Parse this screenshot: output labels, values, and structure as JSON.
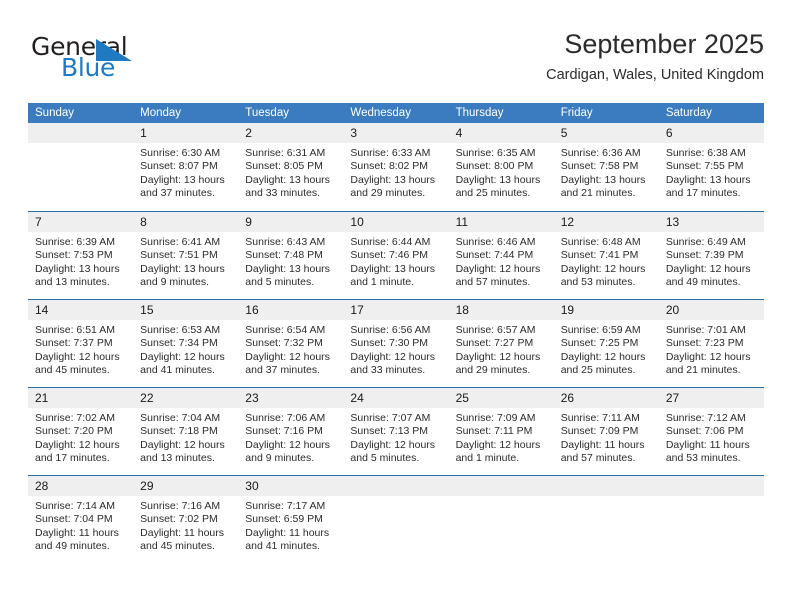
{
  "brand": {
    "name_top": "General",
    "name_bottom": "Blue",
    "triangle_color": "#1f7ac2",
    "top_color": "#231f20"
  },
  "header": {
    "title": "September 2025",
    "location": "Cardigan, Wales, United Kingdom"
  },
  "theme": {
    "header_row_bg": "#3a7cbf",
    "row_divider": "#2b6ca8",
    "day_band_bg": "#efefef",
    "text": "#2b2b2b"
  },
  "weekdays": [
    "Sunday",
    "Monday",
    "Tuesday",
    "Wednesday",
    "Thursday",
    "Friday",
    "Saturday"
  ],
  "weeks": [
    [
      {
        "day": "",
        "lines": []
      },
      {
        "day": "1",
        "lines": [
          "Sunrise: 6:30 AM",
          "Sunset: 8:07 PM",
          "Daylight: 13 hours",
          "and 37 minutes."
        ]
      },
      {
        "day": "2",
        "lines": [
          "Sunrise: 6:31 AM",
          "Sunset: 8:05 PM",
          "Daylight: 13 hours",
          "and 33 minutes."
        ]
      },
      {
        "day": "3",
        "lines": [
          "Sunrise: 6:33 AM",
          "Sunset: 8:02 PM",
          "Daylight: 13 hours",
          "and 29 minutes."
        ]
      },
      {
        "day": "4",
        "lines": [
          "Sunrise: 6:35 AM",
          "Sunset: 8:00 PM",
          "Daylight: 13 hours",
          "and 25 minutes."
        ]
      },
      {
        "day": "5",
        "lines": [
          "Sunrise: 6:36 AM",
          "Sunset: 7:58 PM",
          "Daylight: 13 hours",
          "and 21 minutes."
        ]
      },
      {
        "day": "6",
        "lines": [
          "Sunrise: 6:38 AM",
          "Sunset: 7:55 PM",
          "Daylight: 13 hours",
          "and 17 minutes."
        ]
      }
    ],
    [
      {
        "day": "7",
        "lines": [
          "Sunrise: 6:39 AM",
          "Sunset: 7:53 PM",
          "Daylight: 13 hours",
          "and 13 minutes."
        ]
      },
      {
        "day": "8",
        "lines": [
          "Sunrise: 6:41 AM",
          "Sunset: 7:51 PM",
          "Daylight: 13 hours",
          "and 9 minutes."
        ]
      },
      {
        "day": "9",
        "lines": [
          "Sunrise: 6:43 AM",
          "Sunset: 7:48 PM",
          "Daylight: 13 hours",
          "and 5 minutes."
        ]
      },
      {
        "day": "10",
        "lines": [
          "Sunrise: 6:44 AM",
          "Sunset: 7:46 PM",
          "Daylight: 13 hours",
          "and 1 minute."
        ]
      },
      {
        "day": "11",
        "lines": [
          "Sunrise: 6:46 AM",
          "Sunset: 7:44 PM",
          "Daylight: 12 hours",
          "and 57 minutes."
        ]
      },
      {
        "day": "12",
        "lines": [
          "Sunrise: 6:48 AM",
          "Sunset: 7:41 PM",
          "Daylight: 12 hours",
          "and 53 minutes."
        ]
      },
      {
        "day": "13",
        "lines": [
          "Sunrise: 6:49 AM",
          "Sunset: 7:39 PM",
          "Daylight: 12 hours",
          "and 49 minutes."
        ]
      }
    ],
    [
      {
        "day": "14",
        "lines": [
          "Sunrise: 6:51 AM",
          "Sunset: 7:37 PM",
          "Daylight: 12 hours",
          "and 45 minutes."
        ]
      },
      {
        "day": "15",
        "lines": [
          "Sunrise: 6:53 AM",
          "Sunset: 7:34 PM",
          "Daylight: 12 hours",
          "and 41 minutes."
        ]
      },
      {
        "day": "16",
        "lines": [
          "Sunrise: 6:54 AM",
          "Sunset: 7:32 PM",
          "Daylight: 12 hours",
          "and 37 minutes."
        ]
      },
      {
        "day": "17",
        "lines": [
          "Sunrise: 6:56 AM",
          "Sunset: 7:30 PM",
          "Daylight: 12 hours",
          "and 33 minutes."
        ]
      },
      {
        "day": "18",
        "lines": [
          "Sunrise: 6:57 AM",
          "Sunset: 7:27 PM",
          "Daylight: 12 hours",
          "and 29 minutes."
        ]
      },
      {
        "day": "19",
        "lines": [
          "Sunrise: 6:59 AM",
          "Sunset: 7:25 PM",
          "Daylight: 12 hours",
          "and 25 minutes."
        ]
      },
      {
        "day": "20",
        "lines": [
          "Sunrise: 7:01 AM",
          "Sunset: 7:23 PM",
          "Daylight: 12 hours",
          "and 21 minutes."
        ]
      }
    ],
    [
      {
        "day": "21",
        "lines": [
          "Sunrise: 7:02 AM",
          "Sunset: 7:20 PM",
          "Daylight: 12 hours",
          "and 17 minutes."
        ]
      },
      {
        "day": "22",
        "lines": [
          "Sunrise: 7:04 AM",
          "Sunset: 7:18 PM",
          "Daylight: 12 hours",
          "and 13 minutes."
        ]
      },
      {
        "day": "23",
        "lines": [
          "Sunrise: 7:06 AM",
          "Sunset: 7:16 PM",
          "Daylight: 12 hours",
          "and 9 minutes."
        ]
      },
      {
        "day": "24",
        "lines": [
          "Sunrise: 7:07 AM",
          "Sunset: 7:13 PM",
          "Daylight: 12 hours",
          "and 5 minutes."
        ]
      },
      {
        "day": "25",
        "lines": [
          "Sunrise: 7:09 AM",
          "Sunset: 7:11 PM",
          "Daylight: 12 hours",
          "and 1 minute."
        ]
      },
      {
        "day": "26",
        "lines": [
          "Sunrise: 7:11 AM",
          "Sunset: 7:09 PM",
          "Daylight: 11 hours",
          "and 57 minutes."
        ]
      },
      {
        "day": "27",
        "lines": [
          "Sunrise: 7:12 AM",
          "Sunset: 7:06 PM",
          "Daylight: 11 hours",
          "and 53 minutes."
        ]
      }
    ],
    [
      {
        "day": "28",
        "lines": [
          "Sunrise: 7:14 AM",
          "Sunset: 7:04 PM",
          "Daylight: 11 hours",
          "and 49 minutes."
        ]
      },
      {
        "day": "29",
        "lines": [
          "Sunrise: 7:16 AM",
          "Sunset: 7:02 PM",
          "Daylight: 11 hours",
          "and 45 minutes."
        ]
      },
      {
        "day": "30",
        "lines": [
          "Sunrise: 7:17 AM",
          "Sunset: 6:59 PM",
          "Daylight: 11 hours",
          "and 41 minutes."
        ]
      },
      {
        "day": "",
        "lines": []
      },
      {
        "day": "",
        "lines": []
      },
      {
        "day": "",
        "lines": []
      },
      {
        "day": "",
        "lines": []
      }
    ]
  ]
}
